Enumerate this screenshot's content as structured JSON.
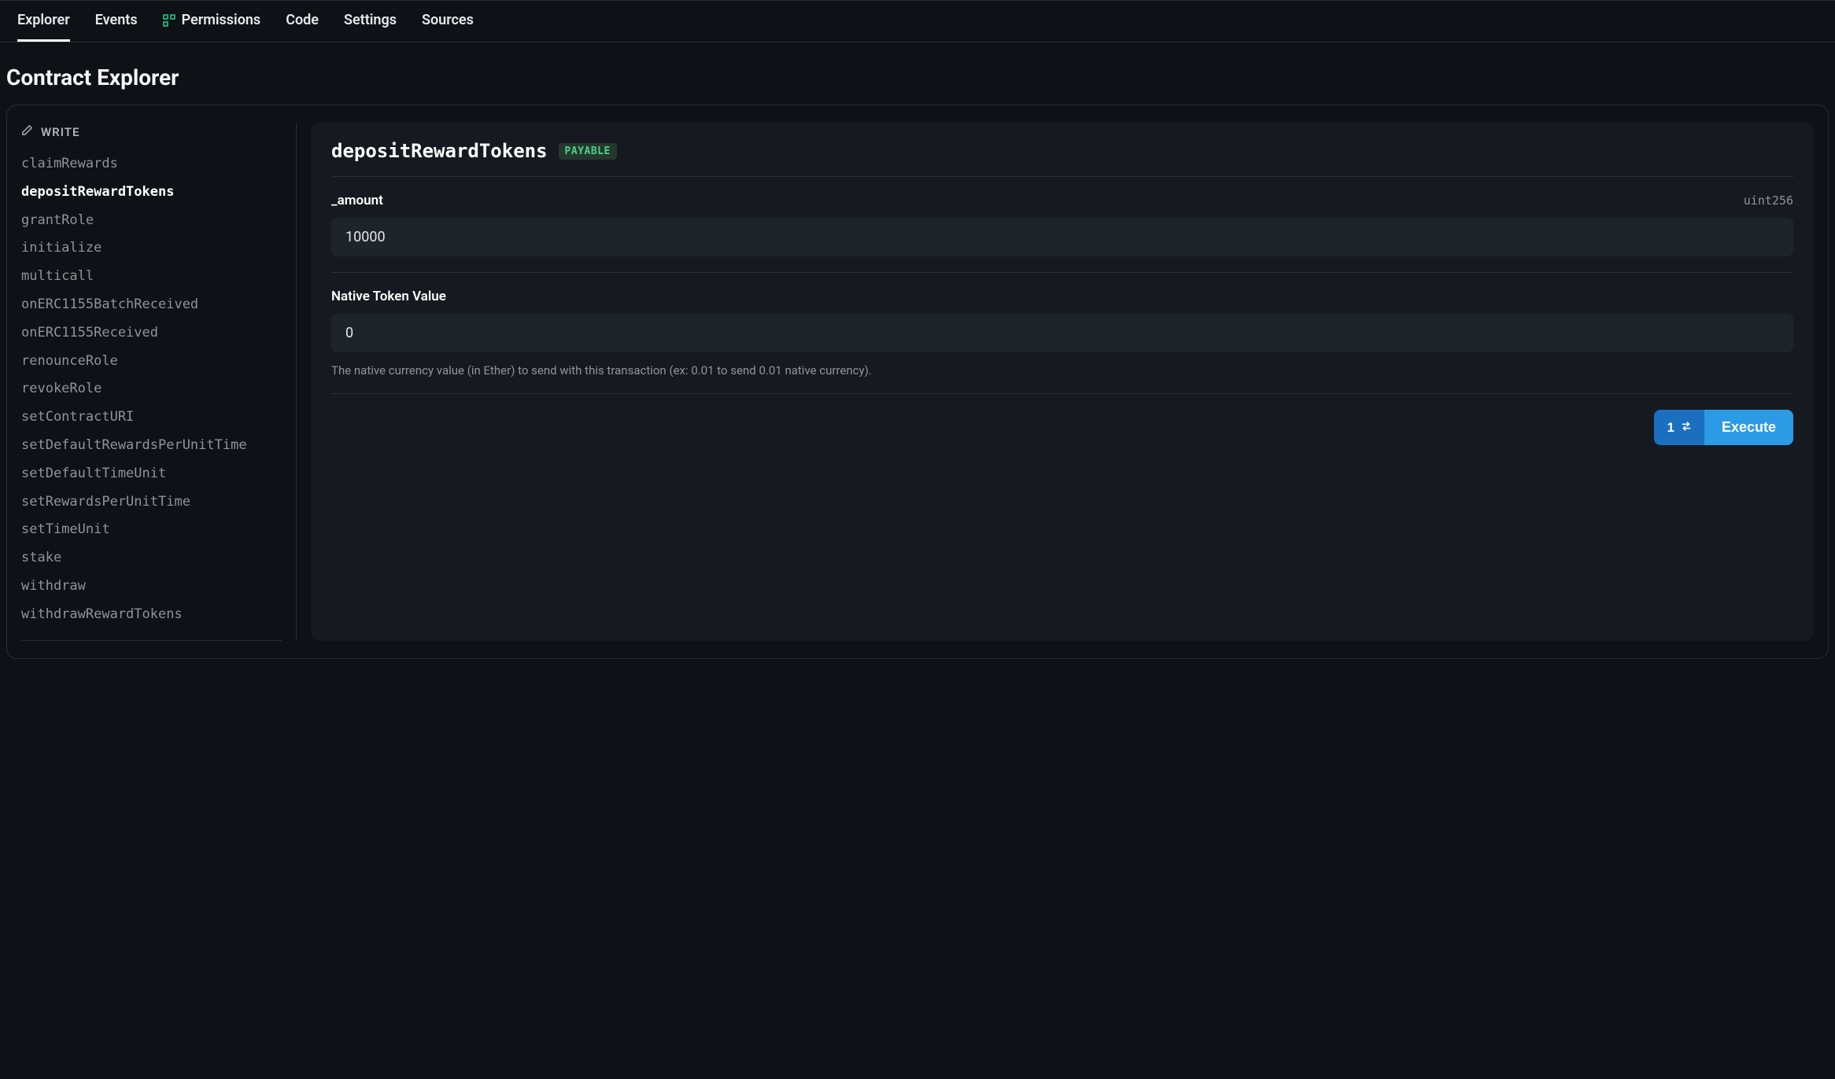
{
  "tabs": {
    "explorer": "Explorer",
    "events": "Events",
    "permissions": "Permissions",
    "code": "Code",
    "settings": "Settings",
    "sources": "Sources"
  },
  "page": {
    "title": "Contract Explorer"
  },
  "sidebar": {
    "section_label": "WRITE",
    "selected": "depositRewardTokens",
    "functions": [
      "claimRewards",
      "depositRewardTokens",
      "grantRole",
      "initialize",
      "multicall",
      "onERC1155BatchReceived",
      "onERC1155Received",
      "renounceRole",
      "revokeRole",
      "setContractURI",
      "setDefaultRewardsPerUnitTime",
      "setDefaultTimeUnit",
      "setRewardsPerUnitTime",
      "setTimeUnit",
      "stake",
      "withdraw",
      "withdrawRewardTokens"
    ]
  },
  "function_panel": {
    "name": "depositRewardTokens",
    "badge": "PAYABLE",
    "params": [
      {
        "label": "_amount",
        "type": "uint256",
        "value": "10000"
      }
    ],
    "native": {
      "label": "Native Token Value",
      "value": "0",
      "helper": "The native currency value (in Ether) to send with this transaction (ex: 0.01 to send 0.01 native currency)."
    },
    "exec_count": "1",
    "execute_label": "Execute"
  }
}
